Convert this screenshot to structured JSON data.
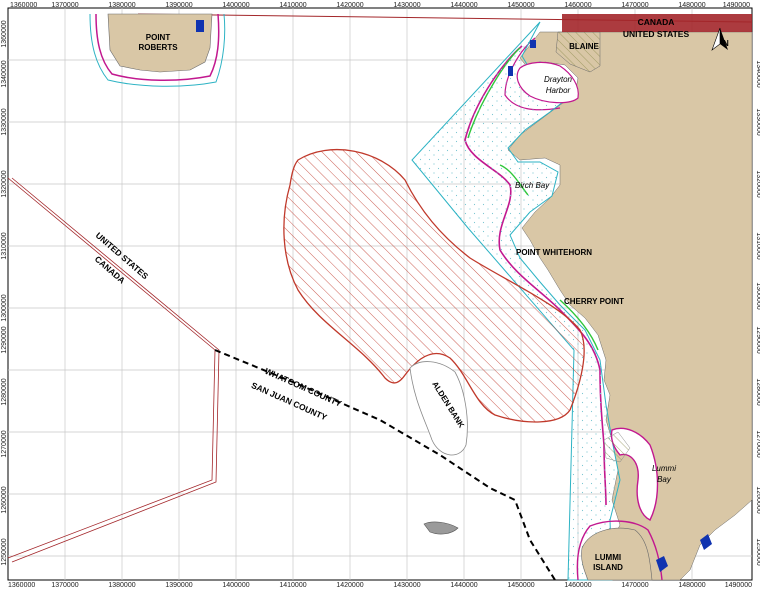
{
  "map": {
    "x_ticks": [
      "1360000",
      "1370000",
      "1380000",
      "1390000",
      "1400000",
      "1410000",
      "1420000",
      "1430000",
      "1440000",
      "1450000",
      "1460000",
      "1470000",
      "1480000",
      "1490000"
    ],
    "y_ticks": [
      "1340000",
      "1330000",
      "1320000",
      "1310000",
      "1300000",
      "1290000",
      "1280000",
      "1270000",
      "1260000",
      "1250000"
    ],
    "y_ticks_top": [
      "1360000"
    ],
    "labels": {
      "point_roberts": [
        "POINT",
        "ROBERTS"
      ],
      "blaine": "BLAINE",
      "canada_top": "CANADA",
      "us_top": "UNITED STATES",
      "drayton_harbor": [
        "Drayton",
        "Harbor"
      ],
      "birch_bay": "Birch Bay",
      "point_whitehorn": "POINT WHITEHORN",
      "cherry_point": "CHERRY POINT",
      "us_diagonal": "UNITED STATES",
      "canada_diagonal": "CANADA",
      "whatcom_county": "WHATCOM COUNTY",
      "san_juan_county": "SAN JUAN COUNTY",
      "alden_bank": "ALDEN BANK",
      "lummi_bay": [
        "Lummi",
        "Bay"
      ],
      "lummi_island": [
        "LUMMI",
        "ISLAND"
      ],
      "north_arrow": "N"
    },
    "colors": {
      "land": "#d9c7a6",
      "border_red": "#a3262a",
      "hatch_red": "#c0392b",
      "magenta": "#c2188f",
      "cyan": "#2db3c4",
      "green": "#2fc73a",
      "blue": "#1033b0",
      "grid": "#c8c8c8"
    }
  }
}
